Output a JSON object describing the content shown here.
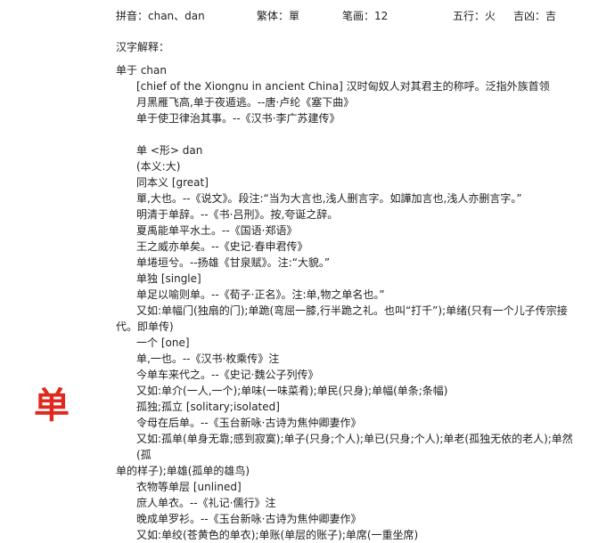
{
  "character": "单",
  "header": {
    "pinyin": "拼音：chan、dan",
    "traditional": "繁体：單",
    "strokes": "笔画：12",
    "wuxing": "五行：火",
    "jixiong": "吉凶：吉"
  },
  "explain_title": "汉字解释：",
  "lines": [
    {
      "kind": "entry",
      "text": "单于 chan"
    },
    {
      "kind": "sub",
      "text": "[chief of the Xiongnu in ancient China] 汉时匈奴人对其君主的称呼。泛指外族首领"
    },
    {
      "kind": "sub",
      "text": "月黑雁飞高,单于夜遁逃。--唐·卢纶《塞下曲》"
    },
    {
      "kind": "sub",
      "text": "单于使卫律治其事。--《汉书·李广苏建传》"
    },
    {
      "kind": "blank",
      "text": ""
    },
    {
      "kind": "sub",
      "text": "单 <形> dan"
    },
    {
      "kind": "sub",
      "text": "(本义:大)"
    },
    {
      "kind": "sub",
      "text": "同本义 [great]"
    },
    {
      "kind": "sub",
      "text": "單,大也。--《说文》。段注:“当为大言也,浅人删言字。如譁加言也,浅人亦删言字。”"
    },
    {
      "kind": "sub",
      "text": "明清于单辞。--《书·吕刑》。按,夸诞之辞。"
    },
    {
      "kind": "sub",
      "text": "夏禹能单平水土。--《国语·郑语》"
    },
    {
      "kind": "sub",
      "text": "王之威亦单矣。--《史记·春申君传》"
    },
    {
      "kind": "sub",
      "text": "单埢垣兮。--扬雄《甘泉赋》。注:“大貌。”"
    },
    {
      "kind": "sub",
      "text": "单独 [single]"
    },
    {
      "kind": "sub",
      "text": "单足以喻则单。--《荀子·正名》。注:单,物之单名也。”"
    },
    {
      "kind": "wrap",
      "text": "又如:单幅门(独扇的门);单跪(弯屈一膝,行半跪之礼。也叫“打千”);单绪(只有一个儿子传宗接"
    },
    {
      "kind": "wrap-cont",
      "text": "代。即单传)"
    },
    {
      "kind": "sub",
      "text": "一个 [one]"
    },
    {
      "kind": "sub",
      "text": "单,一也。--《汉书·枚乘传》注"
    },
    {
      "kind": "sub",
      "text": "今单车来代之。--《史记·魏公子列传》"
    },
    {
      "kind": "sub",
      "text": "又如:单介(一人,一个);单味(一味菜肴);单民(只身);单幅(单条;条幅)"
    },
    {
      "kind": "sub",
      "text": "孤独;孤立 [solitary;isolated]"
    },
    {
      "kind": "sub",
      "text": "令母在后单。--《玉台新咏·古诗为焦仲卿妻作》"
    },
    {
      "kind": "wrap",
      "text": "又如:孤单(单身无靠;感到寂寞);单子(只身;个人);单已(只身;个人);单老(孤独无依的老人);单然(孤"
    },
    {
      "kind": "wrap-cont",
      "text": "单的样子);单雄(孤单的雄鸟)"
    },
    {
      "kind": "sub",
      "text": "衣物等单层 [unlined]"
    },
    {
      "kind": "sub",
      "text": "庶人单衣。--《礼记·儒行》注"
    },
    {
      "kind": "sub",
      "text": "晚成单罗衫。--《玉台新咏·古诗为焦仲卿妻作》"
    },
    {
      "kind": "sub",
      "text": "又如:单绞(苍黄色的单衣);单账(单层的账子);单席(一重坐席)"
    }
  ]
}
